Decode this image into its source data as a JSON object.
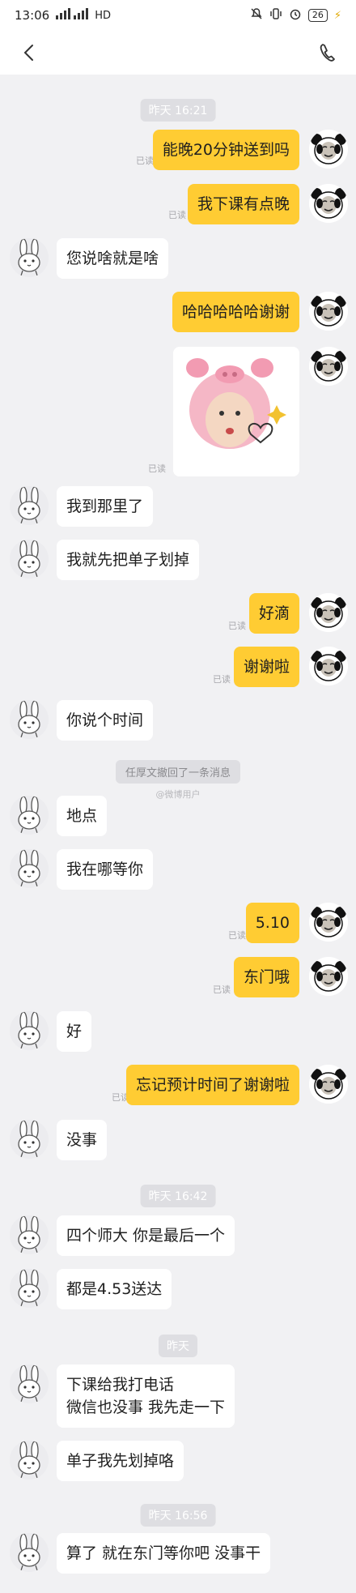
{
  "status_bar": {
    "time": "13:06",
    "network": "HD",
    "battery": "26"
  },
  "nav": {
    "back_icon": "chevron-left-icon",
    "call_icon": "phone-icon"
  },
  "colors": {
    "background": "#f1f1f3",
    "my_bubble": "#ffcc33",
    "their_bubble": "#ffffff",
    "time_pill": "#dedee2"
  },
  "read_label": "已读",
  "timestamps": [
    "昨天 16:21",
    "昨天 16:42",
    "昨天",
    "昨天 16:56"
  ],
  "system_notice": "任厚文撤回了一条消息",
  "watermark": "@微博用户",
  "messages": [
    {
      "side": "right",
      "text": "能晚20分钟送到吗"
    },
    {
      "side": "right",
      "text": "我下课有点晚"
    },
    {
      "side": "left",
      "text": "您说啥就是啥"
    },
    {
      "side": "right",
      "text": "哈哈哈哈哈谢谢"
    },
    {
      "side": "right",
      "type": "sticker",
      "text": ""
    },
    {
      "side": "left",
      "text": "我到那里了"
    },
    {
      "side": "left",
      "text": "我就先把单子划掉"
    },
    {
      "side": "right",
      "text": "好滴"
    },
    {
      "side": "right",
      "text": "谢谢啦"
    },
    {
      "side": "left",
      "text": "你说个时间"
    },
    {
      "side": "left",
      "text": "地点"
    },
    {
      "side": "left",
      "text": "我在哪等你"
    },
    {
      "side": "right",
      "text": "5.10"
    },
    {
      "side": "right",
      "text": "东门哦"
    },
    {
      "side": "left",
      "text": "好"
    },
    {
      "side": "right",
      "text": "忘记预计时间了谢谢啦"
    },
    {
      "side": "left",
      "text": "没事"
    },
    {
      "side": "left",
      "text": "四个师大 你是最后一个"
    },
    {
      "side": "left",
      "text": "都是4.53送达"
    },
    {
      "side": "left",
      "text": "下课给我打电话",
      "line2": "微信也没事  我先走一下"
    },
    {
      "side": "left",
      "text": "单子我先划掉咯"
    },
    {
      "side": "left",
      "text": "算了 就在东门等你吧  没事干"
    }
  ]
}
